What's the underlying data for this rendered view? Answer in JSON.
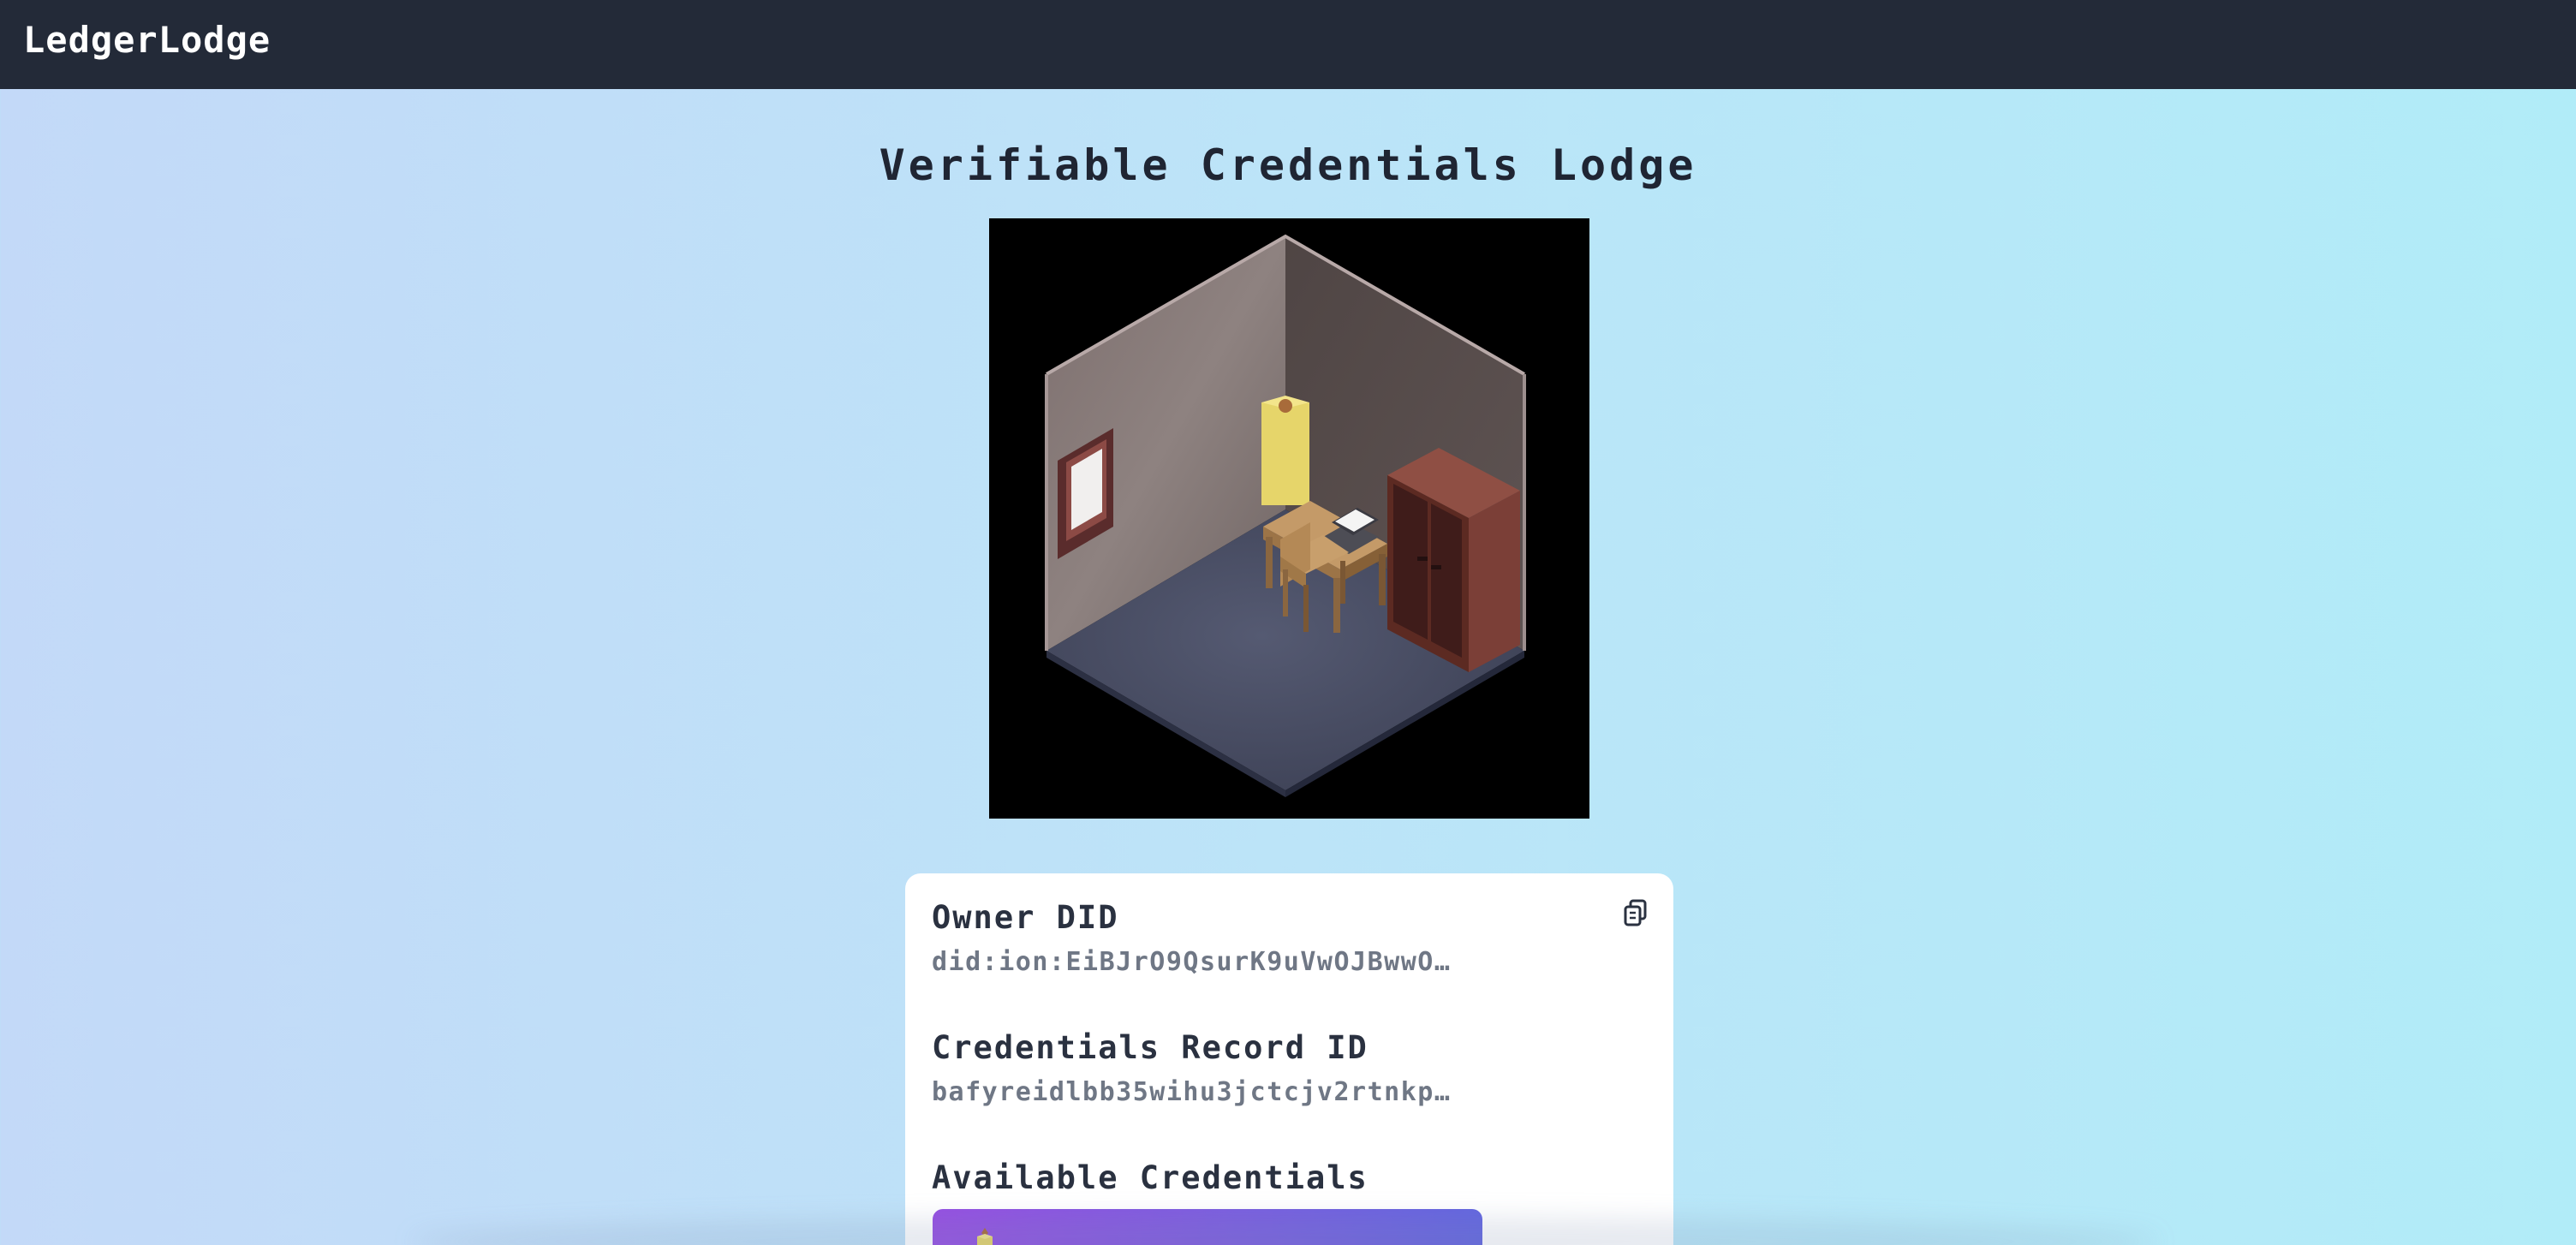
{
  "header": {
    "brand": "LedgerLodge"
  },
  "page": {
    "title": "Verifiable Credentials Lodge"
  },
  "room_image": {
    "description_icon": "isometric-room-image"
  },
  "details": {
    "owner_did_label": "Owner DID",
    "owner_did_value": "did:ion:EiBJrO9QsurK9uVwOJBwwO…",
    "record_id_label": "Credentials Record ID",
    "record_id_value": "bafyreidlbb35wihu3jctcjv2rtnkp…",
    "available_label": "Available Credentials",
    "copy_icon": "copy-icon"
  },
  "colors": {
    "topbar": "#232a38",
    "title": "#1f2533",
    "card": "#ffffff",
    "credential_gradient_start": "#9650e2",
    "credential_gradient_end": "#6366e0"
  }
}
